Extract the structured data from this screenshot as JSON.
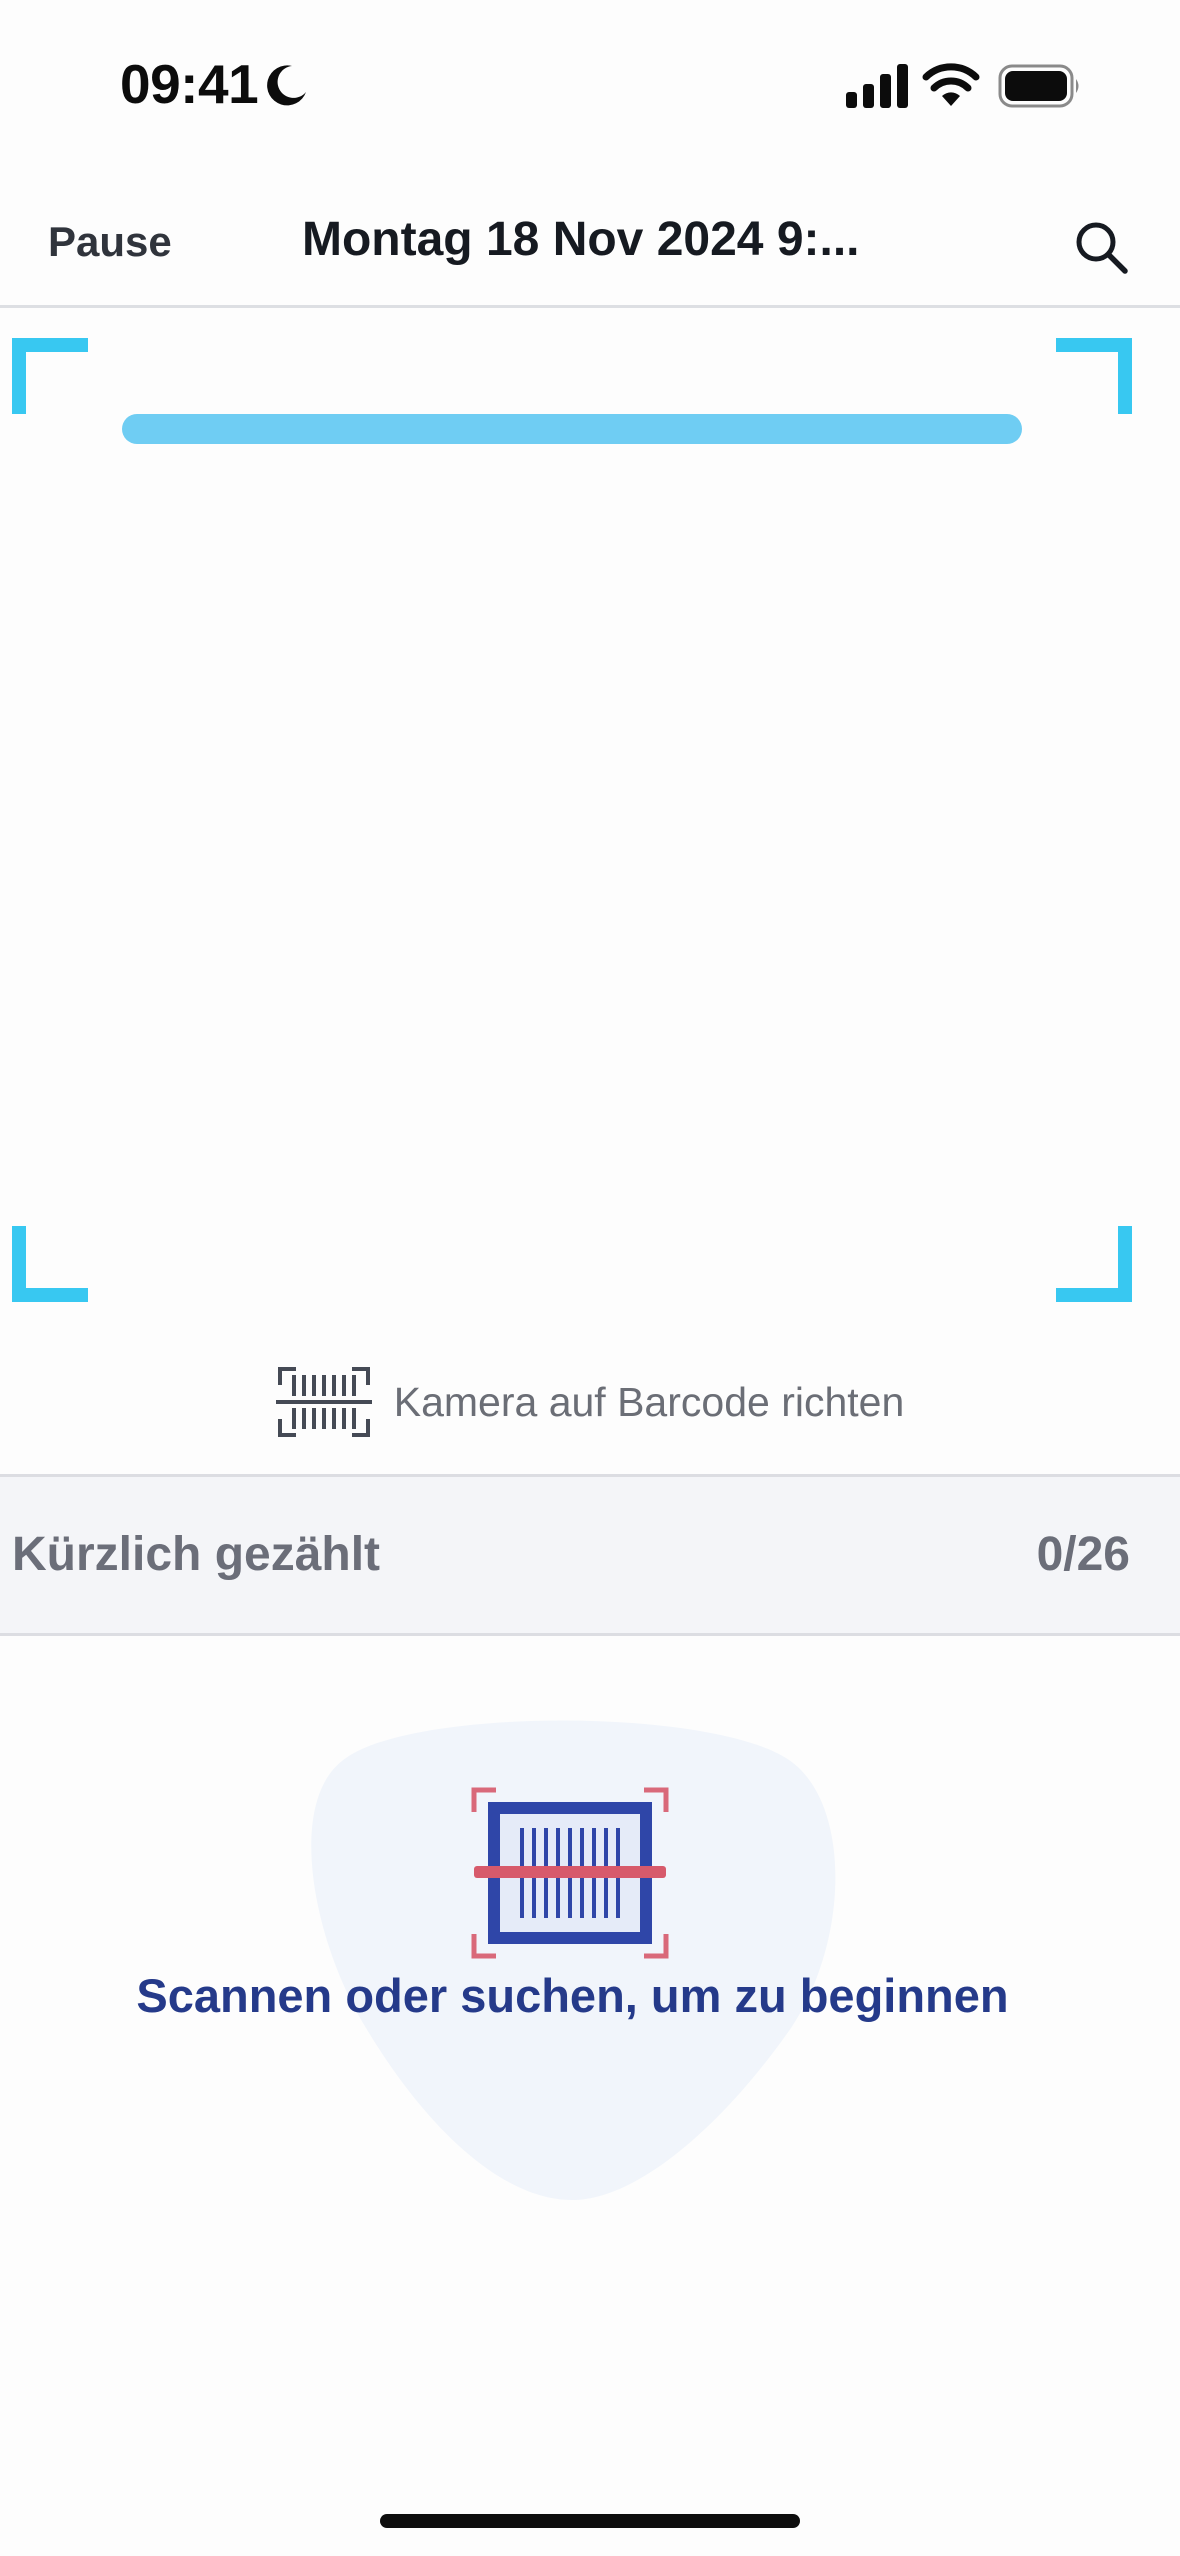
{
  "status_bar": {
    "time": "09:41",
    "focus_icon": "moon-icon",
    "signal_icon": "cellular-signal-icon",
    "wifi_icon": "wifi-icon",
    "battery_icon": "battery-icon"
  },
  "nav": {
    "left_action": "Pause",
    "title": "Montag 18 Nov 2024 9:...",
    "right_icon": "search-icon"
  },
  "scanner": {
    "accent_color": "#38c8f1",
    "hint_icon": "barcode-scan-icon",
    "hint": "Kamera auf Barcode richten"
  },
  "recent": {
    "label": "Kürzlich gezählt",
    "count": "0/26"
  },
  "empty_state": {
    "illustration": "barcode-scanner-illustration",
    "message": "Scannen oder suchen, um zu beginnen",
    "message_color": "#253a8a"
  }
}
